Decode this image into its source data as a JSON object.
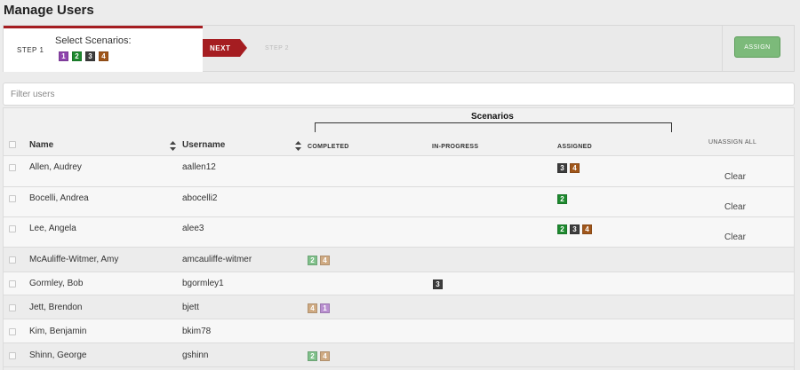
{
  "page_title": "Manage Users",
  "steps": {
    "step1_label": "STEP 1",
    "step1_title": "Select Scenarios:",
    "scenarios": [
      {
        "label": "1",
        "color": "#8e44ad"
      },
      {
        "label": "2",
        "color": "#1e8a2f"
      },
      {
        "label": "3",
        "color": "#3d3d3d"
      },
      {
        "label": "4",
        "color": "#a0561a"
      }
    ],
    "next_label": "NEXT",
    "step2_label": "STEP 2",
    "assign_label": "ASSIGN"
  },
  "filter": {
    "placeholder": "Filter users"
  },
  "table": {
    "scenarios_header": "Scenarios",
    "col_name": "Name",
    "col_username": "Username",
    "col_completed": "COMPLETED",
    "col_in_progress": "IN-PROGRESS",
    "col_assigned": "ASSIGNED",
    "unassign_all": "UNASSIGN ALL",
    "rows": [
      {
        "name": "Allen, Audrey",
        "username": "aallen12",
        "completed": [],
        "in_progress": [],
        "assigned": [
          "3",
          "4"
        ],
        "clear": "Clear"
      },
      {
        "name": "Bocelli, Andrea",
        "username": "abocelli2",
        "completed": [],
        "in_progress": [],
        "assigned": [
          "2"
        ],
        "clear": "Clear"
      },
      {
        "name": "Lee, Angela",
        "username": "alee3",
        "completed": [],
        "in_progress": [],
        "assigned": [
          "2",
          "3",
          "4"
        ],
        "clear": "Clear"
      },
      {
        "name": "McAuliffe-Witmer, Amy",
        "username": "amcauliffe-witmer",
        "completed": [
          "2",
          "4"
        ],
        "in_progress": [],
        "assigned": [],
        "clear": ""
      },
      {
        "name": "Gormley, Bob",
        "username": "bgormley1",
        "completed": [],
        "in_progress": [
          "3"
        ],
        "assigned": [],
        "clear": ""
      },
      {
        "name": "Jett, Brendon",
        "username": "bjett",
        "completed": [
          "4",
          "1"
        ],
        "in_progress": [],
        "assigned": [],
        "clear": ""
      },
      {
        "name": "Kim, Benjamin",
        "username": "bkim78",
        "completed": [],
        "in_progress": [],
        "assigned": [],
        "clear": ""
      },
      {
        "name": "Shinn, George",
        "username": "gshinn",
        "completed": [
          "2",
          "4"
        ],
        "in_progress": [],
        "assigned": [],
        "clear": ""
      }
    ]
  },
  "badge_colors": {
    "strong": {
      "1": "#8e44ad",
      "2": "#1e8a2f",
      "3": "#3d3d3d",
      "4": "#a0561a"
    },
    "muted": {
      "1": "#b98fd0",
      "2": "#7fc08a",
      "3": "#3d3d3d",
      "4": "#cfaa82"
    }
  }
}
